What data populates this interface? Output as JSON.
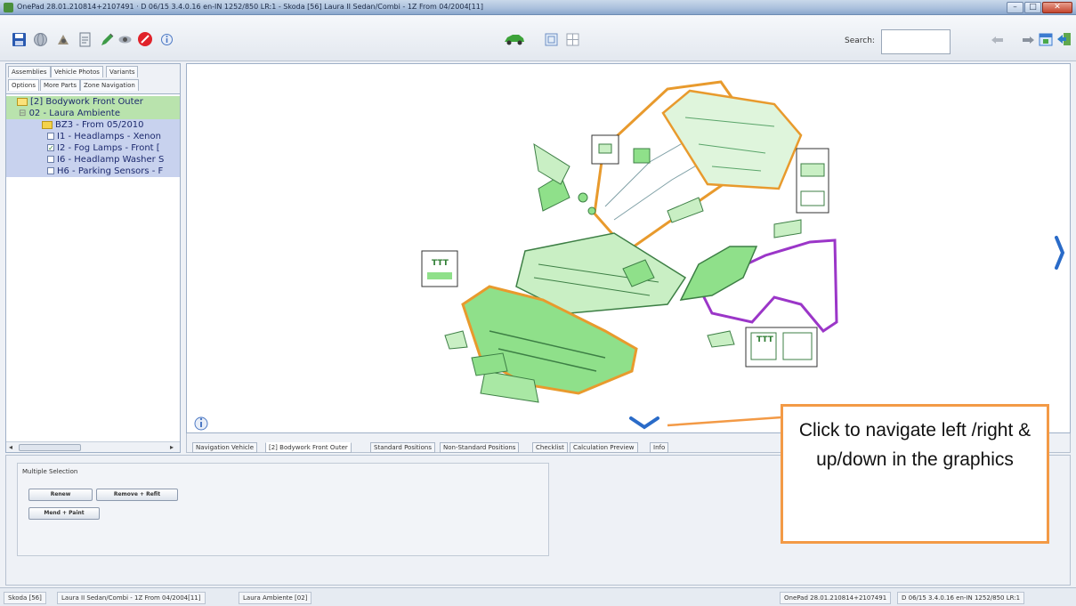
{
  "window": {
    "title": "OnePad 28.01.210814+2107491 · D 06/15 3.4.0.16 en-IN 1252/850 LR:1 - Skoda [56] Laura II Sedan/Combi - 1Z From 04/2004[11]",
    "minimize": "–",
    "maximize": "□",
    "close": "✕"
  },
  "toolbar": {
    "search_label": "Search:",
    "search_value": ""
  },
  "sidebar": {
    "tabs": [
      "Assemblies",
      "Vehicle Photos",
      "Variants",
      "Options",
      "More Parts",
      "Zone Navigation"
    ],
    "tree": [
      {
        "label": "[2] Bodywork Front Outer"
      },
      {
        "label": "02 - Laura Ambiente"
      },
      {
        "label": "BZ3 - From 05/2010"
      },
      {
        "label": "I1 - Headlamps - Xenon"
      },
      {
        "label": "I2 - Fog Lamps - Front [",
        "checked": true
      },
      {
        "label": "I6 - Headlamp Washer S"
      },
      {
        "label": "H6 - Parking Sensors - F"
      }
    ]
  },
  "graphics": {
    "next_right_glyph": "›",
    "next_down_glyph": "⌄",
    "info_glyph": "i"
  },
  "bottom_tabs": [
    "Navigation Vehicle",
    "[2] Bodywork Front Outer",
    "Standard Positions",
    "Non-Standard Positions",
    "Checklist",
    "Calculation Preview",
    "Info"
  ],
  "multiple_selection": {
    "label": "Multiple Selection",
    "buttons": [
      "Renew",
      "Remove + Refit",
      "Mend + Paint"
    ]
  },
  "statusbar": {
    "left": [
      "Skoda [56]",
      "Laura II Sedan/Combi - 1Z From 04/2004[11]",
      "Laura Ambiente [02]"
    ],
    "right": [
      "OnePad 28.01.210814+2107491",
      "D 06/15 3.4.0.16 en-IN 1252/850 LR:1"
    ]
  },
  "callout": {
    "text": "Click to navigate left /right & up/down in the graphics"
  },
  "colors": {
    "accent_green": "#7ed87a",
    "outline_orange": "#f0a03a",
    "outline_purple": "#9b36c8",
    "nav_arrow_blue": "#2a6bc8",
    "callout_border": "#f39a46"
  },
  "icons": [
    "save-icon",
    "globe-icon",
    "parts-icon",
    "checklist-icon",
    "edit-icon",
    "view-icon",
    "stop-icon",
    "info-icon",
    "car-icon",
    "image-frame-icon",
    "grid-icon",
    "back-icon",
    "forward-icon",
    "calendar-icon",
    "exit-icon"
  ]
}
